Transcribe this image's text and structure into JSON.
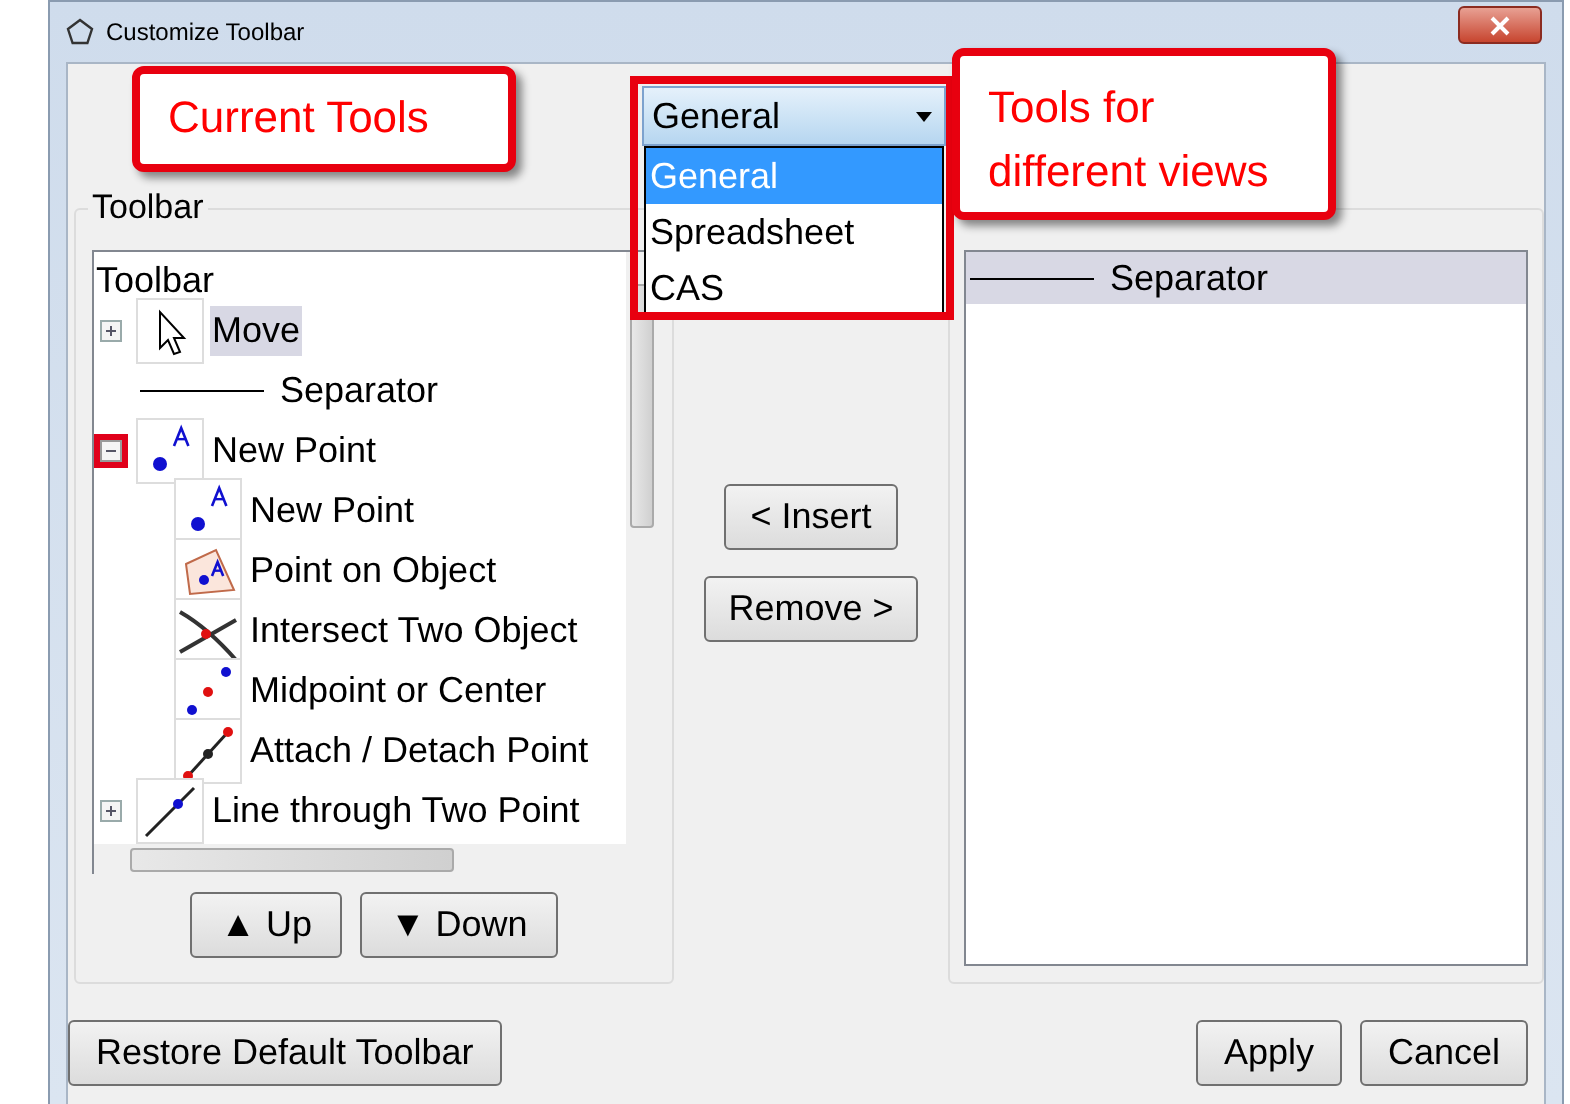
{
  "window": {
    "title": "Customize Toolbar"
  },
  "view_select": {
    "value": "General",
    "expanded": true,
    "options": [
      {
        "label": "General",
        "selected": true
      },
      {
        "label": "Spreadsheet",
        "selected": false
      },
      {
        "label": "CAS",
        "selected": false
      }
    ]
  },
  "toolbar_group": {
    "label": "Toolbar",
    "tree": {
      "root": "Toolbar",
      "items": [
        {
          "label": "Move",
          "kind": "move",
          "selected": true,
          "expanded": false,
          "highlighted_expander": false
        },
        {
          "label": "Separator",
          "kind": "separator",
          "selected": false
        },
        {
          "label": "New Point",
          "kind": "point",
          "selected": false,
          "expanded": true,
          "highlighted_expander": true,
          "children": [
            {
              "label": "New Point",
              "kind": "point",
              "selected": false
            },
            {
              "label": "Point on Object",
              "kind": "point-on-object",
              "selected": false
            },
            {
              "label": "Intersect Two Object",
              "kind": "intersect",
              "selected": false
            },
            {
              "label": "Midpoint or Center",
              "kind": "midpoint",
              "selected": false
            },
            {
              "label": "Attach / Detach Point",
              "kind": "attach",
              "selected": false
            }
          ]
        },
        {
          "label": "Line through Two Point",
          "kind": "line",
          "selected": false,
          "expanded": false,
          "highlighted_expander": false
        }
      ]
    }
  },
  "buttons_move": [
    "▲ Up",
    "▼ Down"
  ],
  "buttons_transfer": [
    "< Insert",
    "Remove >"
  ],
  "tools_list": [
    {
      "label": "Separator",
      "kind": "separator",
      "selected": true
    }
  ],
  "footer": {
    "left": "Restore Default Toolbar",
    "right": [
      "Apply",
      "Cancel"
    ]
  },
  "annotations": [
    {
      "text": "Current Tools",
      "kind": "current"
    },
    {
      "text": "Tools for different views",
      "kind": "views"
    }
  ]
}
